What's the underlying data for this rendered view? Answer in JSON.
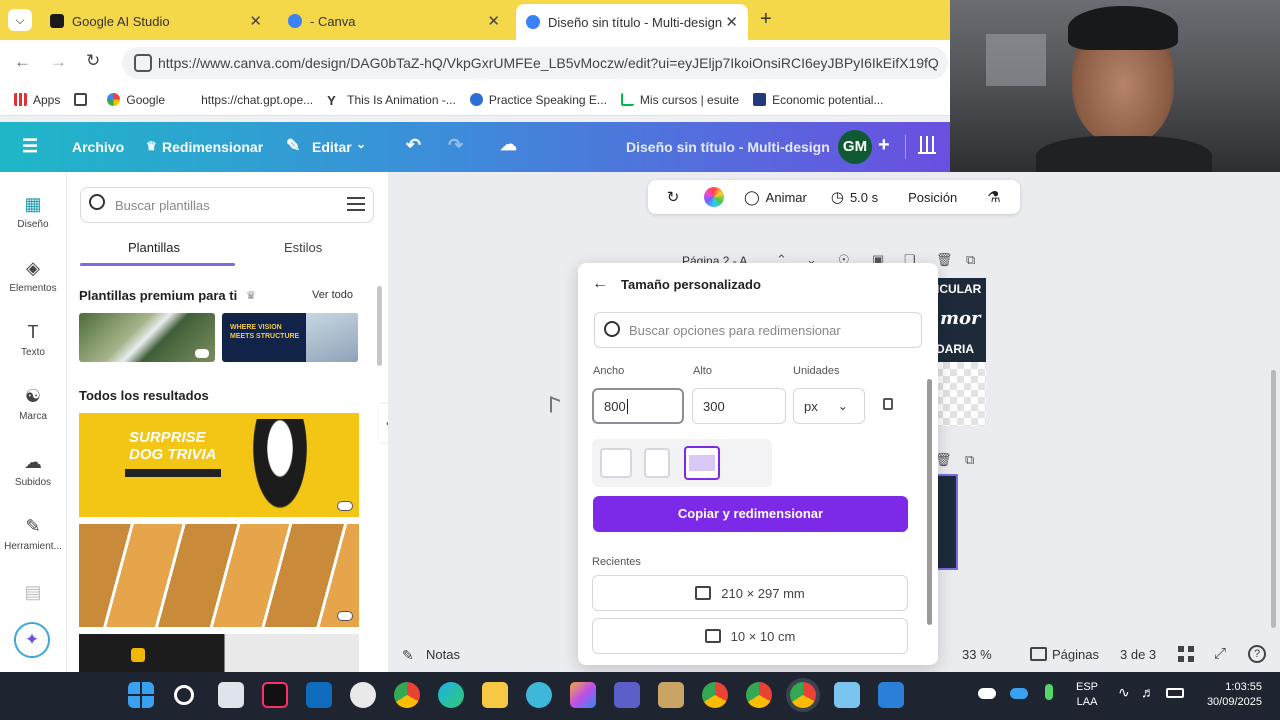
{
  "browser": {
    "tabs": [
      {
        "label": "Google AI Studio",
        "color": "#1a1a1a"
      },
      {
        "label": "- Canva",
        "color": "#3b82f6"
      },
      {
        "label": "Diseño sin título - Multi-design",
        "color": "#3b82f6"
      }
    ],
    "new_tab": "+",
    "url": "https://www.canva.com/design/DAG0bTaZ-hQ/VkpGxrUMFEe_LB5vMoczw/edit?ui=eyJEljp7IkoiOnsiRCI6eyJBPyI6IkEifX19fQ",
    "bookmarks": [
      {
        "label": "Apps"
      },
      {
        "label": "Google"
      },
      {
        "label": "https://chat.gpt.ope..."
      },
      {
        "label": "This Is Animation -..."
      },
      {
        "label": "Practice Speaking E..."
      },
      {
        "label": "Mis cursos | esuite"
      },
      {
        "label": "Economic potential..."
      }
    ]
  },
  "canva_header": {
    "file": "Archivo",
    "resize": "Redimensionar",
    "edit": "Editar",
    "doc_title": "Diseño sin título - Multi-design",
    "avatar": "GM",
    "plus": "+"
  },
  "rail": [
    {
      "label": "Diseño",
      "icon": "design-icon"
    },
    {
      "label": "Elementos",
      "icon": "elements-icon"
    },
    {
      "label": "Texto",
      "icon": "text-icon"
    },
    {
      "label": "Marca",
      "icon": "brand-icon"
    },
    {
      "label": "Subidos",
      "icon": "upload-icon"
    },
    {
      "label": "Herramient...",
      "icon": "tools-icon"
    }
  ],
  "panel": {
    "search_placeholder": "Buscar plantillas",
    "tab_templates": "Plantillas",
    "tab_styles": "Estilos",
    "premium_title": "Plantillas premium para ti",
    "see_all": "Ver todo",
    "all_results": "Todos los resultados",
    "thumb2_text": "WHERE VISION MEETS STRUCTURE",
    "card1_title": "SURPRISE DOG TRIVIA"
  },
  "floatbar": {
    "animate": "Animar",
    "duration": "5.0 s",
    "position": "Posición"
  },
  "page_label": "Página 2 - A",
  "design_preview": {
    "line1": "ICULAR",
    "line2": "mor",
    "line3": "DARIA"
  },
  "popup": {
    "title": "Tamaño personalizado",
    "search_placeholder": "Buscar opciones para redimensionar",
    "width_label": "Ancho",
    "height_label": "Alto",
    "units_label": "Unidades",
    "width_value": "800",
    "height_value": "300",
    "units_value": "px",
    "button": "Copiar y redimensionar",
    "recent_label": "Recientes",
    "recent": [
      "210 × 297 mm",
      "10 × 10 cm"
    ]
  },
  "bottombar": {
    "notes": "Notas",
    "zoom": "33 %",
    "pages": "Páginas",
    "page_count": "3 de 3"
  },
  "taskbar": {
    "lang1": "ESP",
    "lang2": "LAA",
    "time": "1:03:55",
    "date": "30/09/2025"
  },
  "colors": {
    "canva_purple": "#7d2ae8",
    "tabstrip": "#f5d84a",
    "taskbar": "#1e2530"
  }
}
